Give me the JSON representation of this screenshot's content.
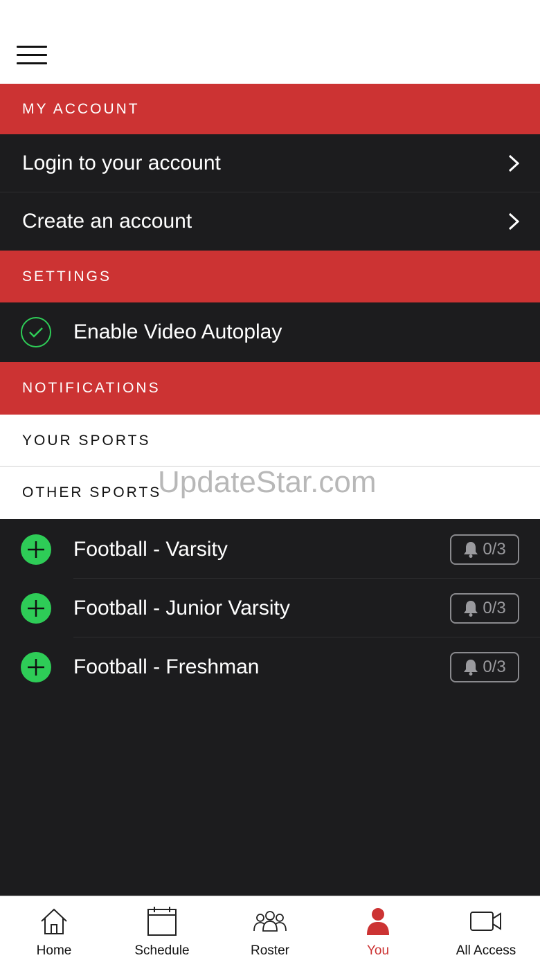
{
  "menu_icon": "hamburger-icon",
  "sections": {
    "my_account": "MY ACCOUNT",
    "settings": "SETTINGS",
    "notifications": "NOTIFICATIONS"
  },
  "account": {
    "login": "Login to your account",
    "create": "Create an account"
  },
  "settings": {
    "autoplay_label": "Enable Video Autoplay",
    "autoplay_enabled": true
  },
  "notifications": {
    "your_sports": "YOUR SPORTS",
    "other_sports": "OTHER SPORTS"
  },
  "watermark": "UpdateStar.com",
  "sports": [
    {
      "name": "Football - Varsity",
      "count": "0/3"
    },
    {
      "name": "Football - Junior Varsity",
      "count": "0/3"
    },
    {
      "name": "Football - Freshman",
      "count": "0/3"
    }
  ],
  "tabs": [
    {
      "label": "Home",
      "icon": "home-icon",
      "active": false
    },
    {
      "label": "Schedule",
      "icon": "calendar-icon",
      "active": false
    },
    {
      "label": "Roster",
      "icon": "roster-icon",
      "active": false
    },
    {
      "label": "You",
      "icon": "person-icon",
      "active": true
    },
    {
      "label": "All Access",
      "icon": "video-camera-icon",
      "active": false
    }
  ],
  "colors": {
    "accent_red": "#cc3333",
    "row_dark": "#1c1c1e",
    "green": "#2ecc57"
  }
}
